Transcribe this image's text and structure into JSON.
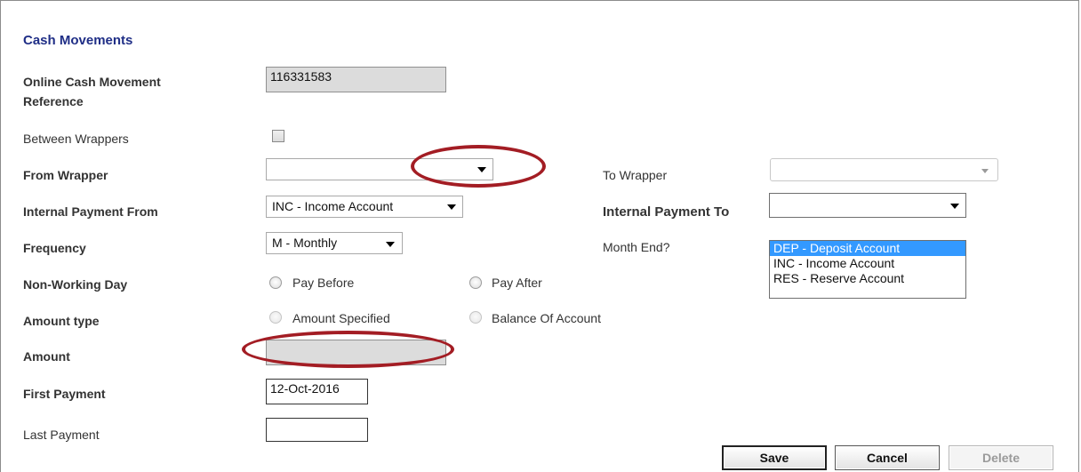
{
  "form": {
    "title": "Cash Movements",
    "reference_label_line1": "Online Cash Movement",
    "reference_label_line2": "Reference",
    "reference_value": "116331583",
    "between_wrappers_label": "Between Wrappers",
    "from_wrapper_label": "From Wrapper",
    "from_wrapper_value": "",
    "to_wrapper_label": "To Wrapper",
    "to_wrapper_value": "",
    "payment_from_label": "Internal Payment From",
    "payment_from_value": "INC - Income Account",
    "payment_to_label": "Internal Payment To",
    "payment_to_value": "",
    "payment_to_options": [
      "",
      "DEP - Deposit Account",
      "INC - Income Account",
      "RES - Reserve Account"
    ],
    "frequency_label": "Frequency",
    "frequency_value": "M - Monthly",
    "month_end_label": "Month End?",
    "non_working_day_label": "Non-Working Day",
    "pay_before_label": "Pay Before",
    "pay_after_label": "Pay After",
    "amount_type_label": "Amount type",
    "amount_specified_label": "Amount Specified",
    "balance_of_account_label": "Balance Of Account",
    "amount_label": "Amount",
    "amount_value": "",
    "first_payment_label": "First Payment",
    "first_payment_value": "12-Oct-2016",
    "last_payment_label": "Last Payment",
    "last_payment_value": ""
  },
  "buttons": {
    "save": "Save",
    "cancel": "Cancel",
    "delete": "Delete"
  },
  "colors": {
    "title": "#1f2e86",
    "annotation": "#a31d24",
    "highlight": "#3399ff"
  }
}
